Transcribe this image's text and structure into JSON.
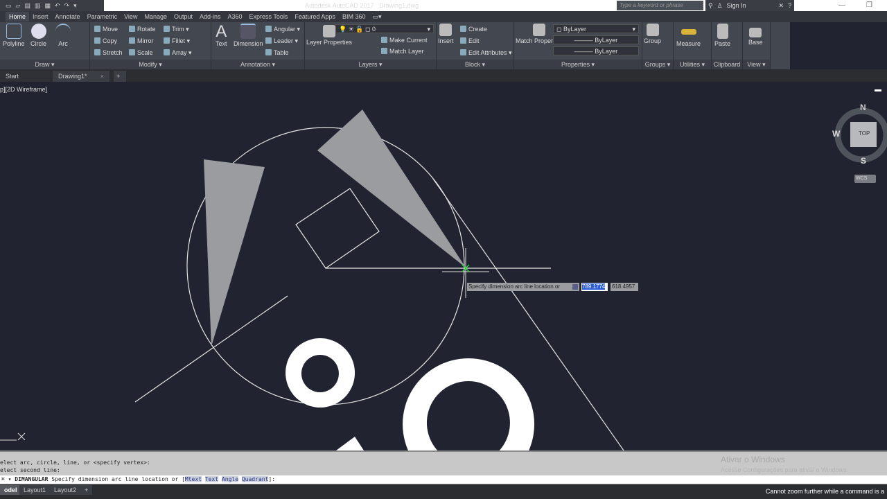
{
  "app": {
    "title": "Autodesk AutoCAD 2017",
    "file": "Drawing1.dwg"
  },
  "search": {
    "placeholder": "Type a keyword or phrase"
  },
  "account": {
    "signin": "Sign In"
  },
  "tabs": [
    "Home",
    "Insert",
    "Annotate",
    "Parametric",
    "View",
    "Manage",
    "Output",
    "Add-ins",
    "A360",
    "Express Tools",
    "Featured Apps",
    "BIM 360"
  ],
  "ribbon": {
    "draw": {
      "title": "Draw",
      "polyline": "Polyline",
      "circle": "Circle",
      "arc": "Arc"
    },
    "modify": {
      "title": "Modify",
      "move": "Move",
      "rotate": "Rotate",
      "trim": "Trim",
      "copy": "Copy",
      "mirror": "Mirror",
      "fillet": "Fillet",
      "stretch": "Stretch",
      "scale": "Scale",
      "array": "Array"
    },
    "annotation": {
      "title": "Annotation",
      "text": "Text",
      "dimension": "Dimension",
      "angular": "Angular",
      "leader": "Leader",
      "table": "Table"
    },
    "layers": {
      "title": "Layers",
      "layer_properties": "Layer Properties",
      "current_layer": "0",
      "make_current": "Make Current",
      "match_layer": "Match Layer"
    },
    "block": {
      "title": "Block",
      "insert": "Insert",
      "create": "Create",
      "edit": "Edit",
      "edit_attributes": "Edit Attributes"
    },
    "properties": {
      "title": "Properties",
      "match_properties": "Match Properties",
      "color": "ByLayer",
      "linetype": "ByLayer",
      "lineweight": "ByLayer"
    },
    "groups": {
      "title": "Groups",
      "group": "Group"
    },
    "utilities": {
      "title": "Utilities",
      "measure": "Measure"
    },
    "clipboard": {
      "title": "Clipboard",
      "paste": "Paste"
    },
    "view": {
      "title": "View",
      "base": "Base"
    }
  },
  "doc_tabs": [
    "Start",
    "Drawing1*"
  ],
  "viewport": {
    "label": "p][2D Wireframe]"
  },
  "viewcube": {
    "n": "N",
    "s": "S",
    "w": "W",
    "face": "TOP",
    "ucs": "WCS"
  },
  "dynamic_input": {
    "prompt": "Specify dimension arc line location or",
    "x": "789.1774",
    "y": "618.4957"
  },
  "command": {
    "history": [
      "elect arc, circle, line, or <specify vertex>:",
      "elect second line:"
    ],
    "name": "DIMANGULAR",
    "prompt": "Specify dimension arc line location or [",
    "options": [
      "Mtext",
      "Text",
      "Angle",
      "Quadrant"
    ],
    "suffix": "]:"
  },
  "watermark": {
    "title": "Ativar o Windows",
    "subtitle": "Acesse Configurações para ativar o Windows."
  },
  "layout_tabs": [
    "odel",
    "Layout1",
    "Layout2"
  ],
  "status": {
    "message": "Cannot zoom further while a command is a"
  }
}
